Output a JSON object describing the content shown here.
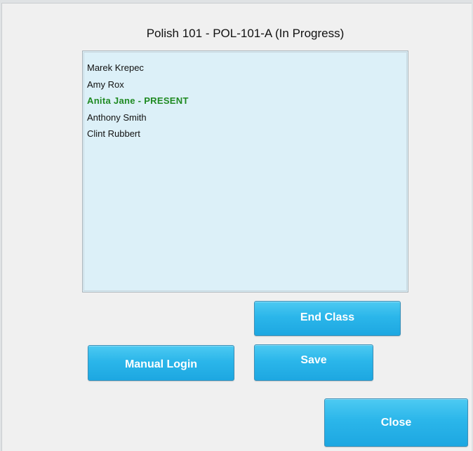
{
  "dialog": {
    "title": "Polish 101 - POL-101-A (In Progress)"
  },
  "attendance_list": {
    "items": [
      {
        "label": "Marek Krepec",
        "status": "normal"
      },
      {
        "label": "Amy Rox",
        "status": "normal"
      },
      {
        "label": "Anita Jane - PRESENT",
        "status": "present"
      },
      {
        "label": "Anthony Smith",
        "status": "normal"
      },
      {
        "label": "Clint Rubbert",
        "status": "normal"
      }
    ]
  },
  "buttons": {
    "end_class": "End Class",
    "manual_login": "Manual Login",
    "save": "Save",
    "close": "Close"
  },
  "colors": {
    "present_text": "#1f8a22",
    "list_background": "#dcf0f8",
    "button_blue": "#2bb6ea"
  }
}
